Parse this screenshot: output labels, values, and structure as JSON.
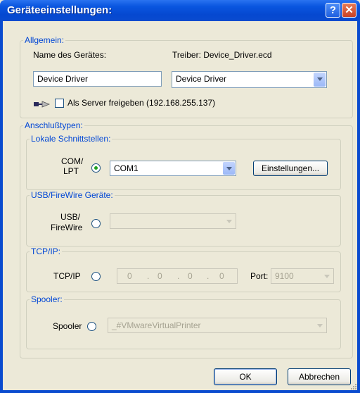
{
  "window": {
    "title": "Geräteeinstellungen:",
    "help_glyph": "?",
    "close_glyph": "✕"
  },
  "allgemein": {
    "legend": "Allgemein:",
    "name_label": "Name des Gerätes:",
    "driver_label": "Treiber: Device_Driver.ecd",
    "name_value": "Device Driver",
    "driver_select": "Device Driver",
    "server_checkbox_label": "Als Server freigeben (192.168.255.137)",
    "server_checked": false
  },
  "anschluss": {
    "legend": "Anschlußtypen:",
    "lokale": {
      "legend": "Lokale Schnittstellen:",
      "label_line1": "COM/",
      "label_line2": "LPT",
      "selected": true,
      "port_select": "COM1",
      "settings_button": "Einstellungen..."
    },
    "usb": {
      "legend": "USB/FireWire Geräte:",
      "label_line1": "USB/",
      "label_line2": "FireWire",
      "selected": false,
      "select_value": ""
    },
    "tcp": {
      "legend": "TCP/IP:",
      "label": "TCP/IP",
      "selected": false,
      "ip": [
        "0",
        "0",
        "0",
        "0"
      ],
      "port_label": "Port:",
      "port_value": "9100"
    },
    "spooler": {
      "legend": "Spooler:",
      "label": "Spooler",
      "selected": false,
      "select_value": "_#VMwareVirtualPrinter"
    }
  },
  "footer": {
    "ok_label": "OK",
    "cancel_label": "Abbrechen"
  }
}
